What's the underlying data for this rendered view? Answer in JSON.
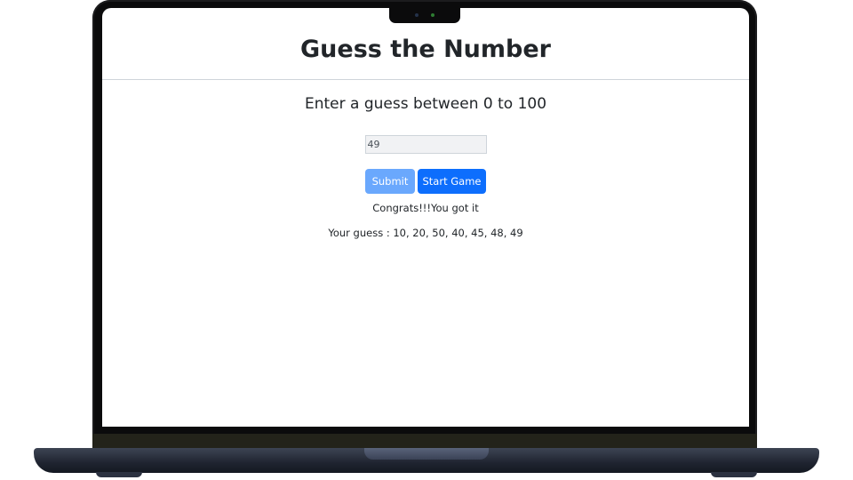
{
  "page": {
    "title": "Guess the Number",
    "prompt": "Enter a guess between 0 to 100"
  },
  "form": {
    "guess_value": "49"
  },
  "buttons": {
    "submit_label": "Submit",
    "start_label": "Start Game"
  },
  "status": {
    "result_text": "Congrats!!!You got it",
    "history_text": "Your guess : 10, 20, 50, 40, 45, 48, 49"
  },
  "colors": {
    "primary": "#0d6efd",
    "primary_disabled": "#6aa8fd",
    "text": "#212529"
  }
}
